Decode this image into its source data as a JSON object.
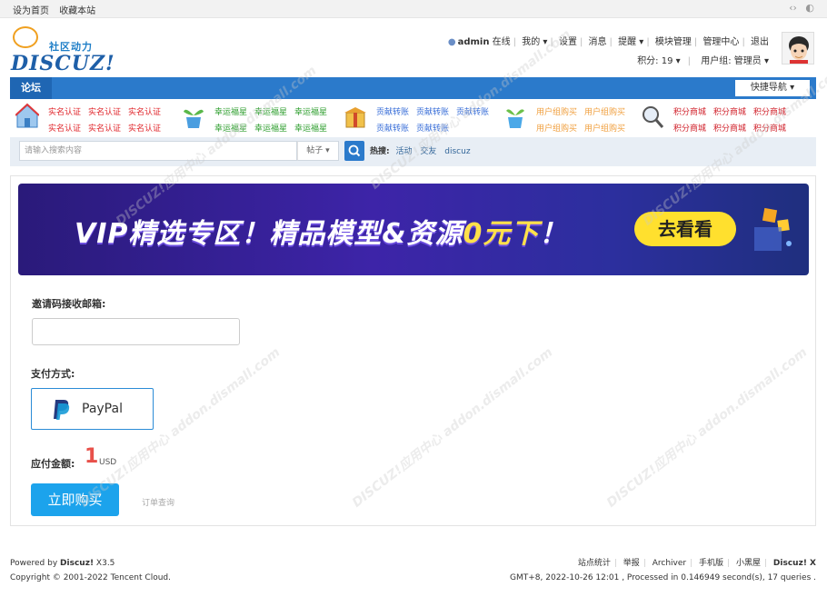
{
  "topbar": {
    "set_home": "设为首页",
    "bookmark": "收藏本站",
    "right_icons": [
      "code-icon",
      "palette-icon"
    ]
  },
  "logo": {
    "zh": "社区动力",
    "en": "DISCUZ!"
  },
  "user": {
    "name": "admin",
    "status": "在线",
    "mine": "我的",
    "settings": "设置",
    "messages": "消息",
    "reminders": "提醒",
    "module_manage": "模块管理",
    "admin_center": "管理中心",
    "logout": "退出",
    "points_label": "积分: 19",
    "group_label": "用户组: 管理员"
  },
  "nav": {
    "home": "论坛",
    "quick_nav": "快捷导航"
  },
  "promo": {
    "groups": [
      {
        "icon": "house-icon",
        "color": "#e0262b",
        "row1": [
          "实名认证",
          "实名认证",
          "实名认证"
        ],
        "row2": [
          "实名认证",
          "实名认证",
          "实名认证"
        ]
      },
      {
        "icon": "plant-icon",
        "color": "#2e9e2e",
        "row1": [
          "幸运福星",
          "幸运福星",
          "幸运福星"
        ],
        "row2": [
          "幸运福星",
          "幸运福星",
          "幸运福星"
        ]
      },
      {
        "icon": "box-icon",
        "color": "#3a6fd8",
        "row1": [
          "贡献转账",
          "贡献转账",
          "贡献转账"
        ],
        "row2": [
          "贡献转账",
          "贡献转账"
        ]
      },
      {
        "icon": "sprout-icon",
        "color": "#f0a040",
        "row1": [
          "用户组购买",
          "用户组购买"
        ],
        "row2": [
          "用户组购买",
          "用户组购买"
        ]
      },
      {
        "icon": "magnifier-icon",
        "color": "#d0202a",
        "row1": [
          "积分商城",
          "积分商城",
          "积分商城"
        ],
        "row2": [
          "积分商城",
          "积分商城",
          "积分商城"
        ]
      }
    ]
  },
  "search": {
    "placeholder": "请输入搜索内容",
    "type": "帖子",
    "hot_label": "热搜:",
    "hot": [
      "活动",
      "交友",
      "discuz"
    ]
  },
  "banner": {
    "text_a": "VIP精选专区！精品模型&资源",
    "text_b": "0元下",
    "text_c": "！",
    "button": "去看看"
  },
  "form": {
    "email_label": "邀请码接收邮箱:",
    "email_value": "",
    "pay_label": "支付方式:",
    "pay_option": "PayPal",
    "amount_label": "应付金额:",
    "amount": "1",
    "currency": "USD",
    "buy_button": "立即购买",
    "order_query": "订单查询"
  },
  "footer": {
    "powered_prefix": "Powered by",
    "powered_name": "Discuz!",
    "powered_ver": "X3.5",
    "copyright": "Copyright © 2001-2022 Tencent Cloud.",
    "links": [
      "站点统计",
      "举报",
      "Archiver",
      "手机版",
      "小黑屋"
    ],
    "brand": "Discuz! X",
    "stats": "GMT+8, 2022-10-26 12:01 , Processed in 0.146949 second(s), 17 queries ."
  },
  "watermark": "DISCUZ!应用中心 addon.dismall.com"
}
